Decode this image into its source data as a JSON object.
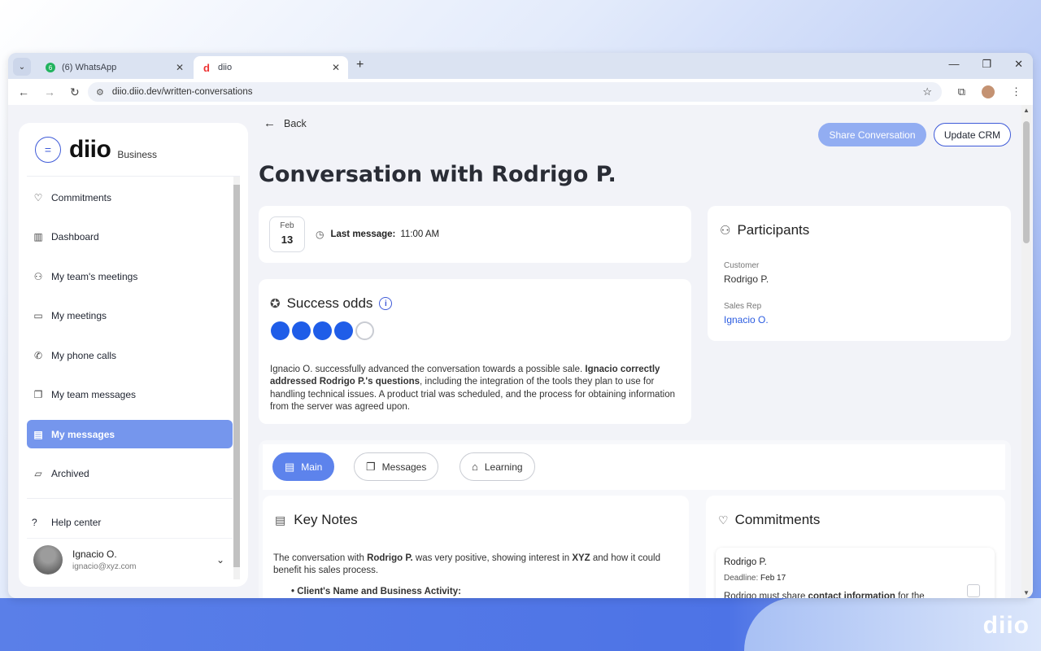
{
  "browser": {
    "tabs": [
      {
        "title": "(6) WhatsApp",
        "active": false
      },
      {
        "title": "diio",
        "active": true
      }
    ],
    "url": "diio.diio.dev/written-conversations"
  },
  "sidebar": {
    "logo": "diio",
    "logo_tag": "Business",
    "items": [
      {
        "label": "Commitments",
        "icon": "heart-handshake-icon"
      },
      {
        "label": "Dashboard",
        "icon": "bar-chart-icon"
      },
      {
        "label": "My team's meetings",
        "icon": "team-icon"
      },
      {
        "label": "My meetings",
        "icon": "video-icon"
      },
      {
        "label": "My phone calls",
        "icon": "phone-icon"
      },
      {
        "label": "My team messages",
        "icon": "chat-bubbles-icon"
      },
      {
        "label": "My messages",
        "icon": "message-icon",
        "active": true
      },
      {
        "label": "Archived",
        "icon": "folder-icon"
      }
    ],
    "help": "Help center",
    "user": {
      "name": "Ignacio O.",
      "email": "ignacio@xyz.com"
    }
  },
  "header": {
    "back": "Back",
    "share": "Share Conversation",
    "crm": "Update CRM",
    "title": "Conversation with Rodrigo P."
  },
  "date": {
    "month": "Feb",
    "day": "13",
    "last_label": "Last message:",
    "last_time": "11:00 AM"
  },
  "odds": {
    "title": "Success odds",
    "score": 4,
    "max": 5,
    "summary_pre": "Ignacio O. successfully advanced the conversation towards a possible sale. ",
    "summary_bold": "Ignacio correctly addressed Rodrigo P.'s questions",
    "summary_post": ", including the integration of the tools they plan to use for handling technical issues. A product trial was scheduled, and the process for obtaining information from the server was agreed upon."
  },
  "participants": {
    "title": "Participants",
    "customer_label": "Customer",
    "customer": "Rodrigo P.",
    "rep_label": "Sales Rep",
    "rep": "Ignacio O."
  },
  "content_tabs": [
    {
      "label": "Main",
      "active": true
    },
    {
      "label": "Messages",
      "active": false
    },
    {
      "label": "Learning",
      "active": false
    }
  ],
  "key_notes": {
    "title": "Key Notes",
    "t1": "The conversation with ",
    "b1": "Rodrigo P.",
    "t2": " was very positive, showing interest in ",
    "b2": "XYZ",
    "t3": " and how it could benefit his sales process.",
    "bullet": "Client's Name and Business Activity:"
  },
  "commitments": {
    "title": "Commitments",
    "item": {
      "name": "Rodrigo P.",
      "deadline_label": "Deadline:",
      "deadline": "Feb 17",
      "desc_pre": "Rodrigo must share ",
      "desc_bold": "contact information",
      "desc_post": " for the"
    }
  },
  "colors": {
    "accent": "#3f5bd8",
    "active_nav": "#7596ed",
    "dot": "#1f5de8"
  }
}
